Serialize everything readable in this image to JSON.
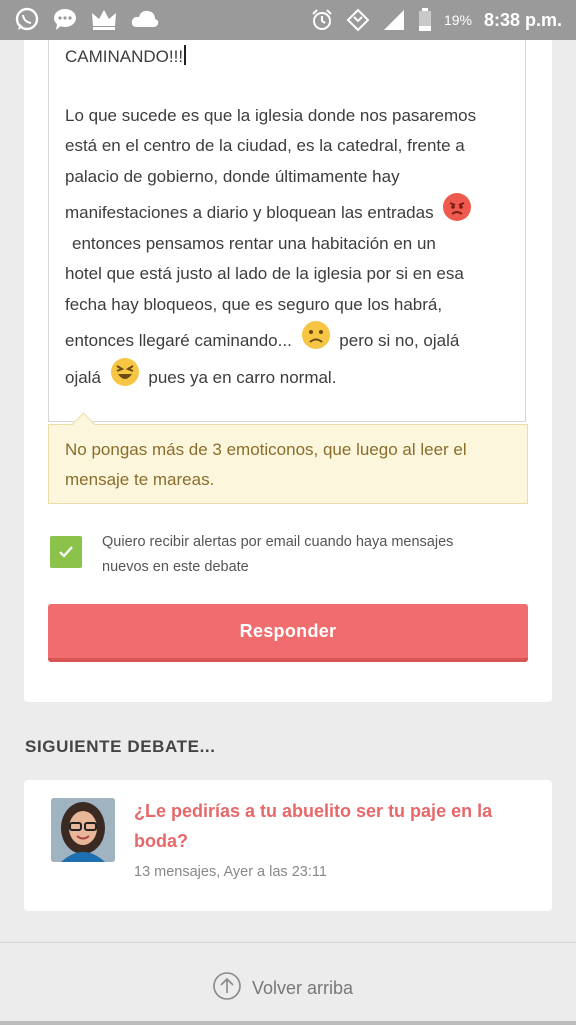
{
  "status_bar": {
    "battery_pct": "19%",
    "time": "8:38 p.m.",
    "icons_left": [
      "whatsapp-icon",
      "chat-icon",
      "crown-icon",
      "cloud-icon"
    ],
    "icons_right": [
      "alarm-icon",
      "data-icon",
      "signal-icon",
      "battery-icon"
    ]
  },
  "reply": {
    "first_line": "CAMINANDO!!!",
    "paragraph": {
      "p1": "Lo que sucede es que la iglesia donde nos pasaremos",
      "p2": "está en el centro de la ciudad, es la catedral, frente a",
      "p3": "palacio de gobierno, donde últimamente hay",
      "p4": "manifestaciones a diario y bloquean las entradas",
      "p5": "entonces pensamos rentar una habitación en un",
      "p6": "hotel que está justo al lado de la iglesia por si en esa",
      "p7": "fecha hay bloqueos, que es seguro que los habrá,",
      "p8a": "entonces llegaré caminando...",
      "p8b": "pero si no, ojalá",
      "p9a": "ojalá",
      "p9b": "pues ya en carro normal."
    },
    "emojis": [
      "angry-emoji",
      "sad-emoji",
      "laughing-emoji"
    ]
  },
  "warning": {
    "line1": "No pongas más de 3 emoticonos, que luego al leer el",
    "line2": "mensaje te mareas."
  },
  "alerts": {
    "checked": true,
    "line1": "Quiero recibir alertas por email cuando haya mensajes",
    "line2": "nuevos en este debate"
  },
  "submit_label": "Responder",
  "next_section": {
    "title": "SIGUIENTE DEBATE...",
    "link_line1": "¿Le pedirías a tu abuelito ser tu paje en la",
    "link_line2": "boda?",
    "meta": "13 mensajes, Ayer a las 23:11"
  },
  "footer": {
    "back_to_top": "Volver arriba"
  },
  "colors": {
    "accent": "#f06c6e",
    "checkbox": "#8bc34a",
    "warning_bg": "#fcf6dc",
    "link": "#e8686a"
  }
}
